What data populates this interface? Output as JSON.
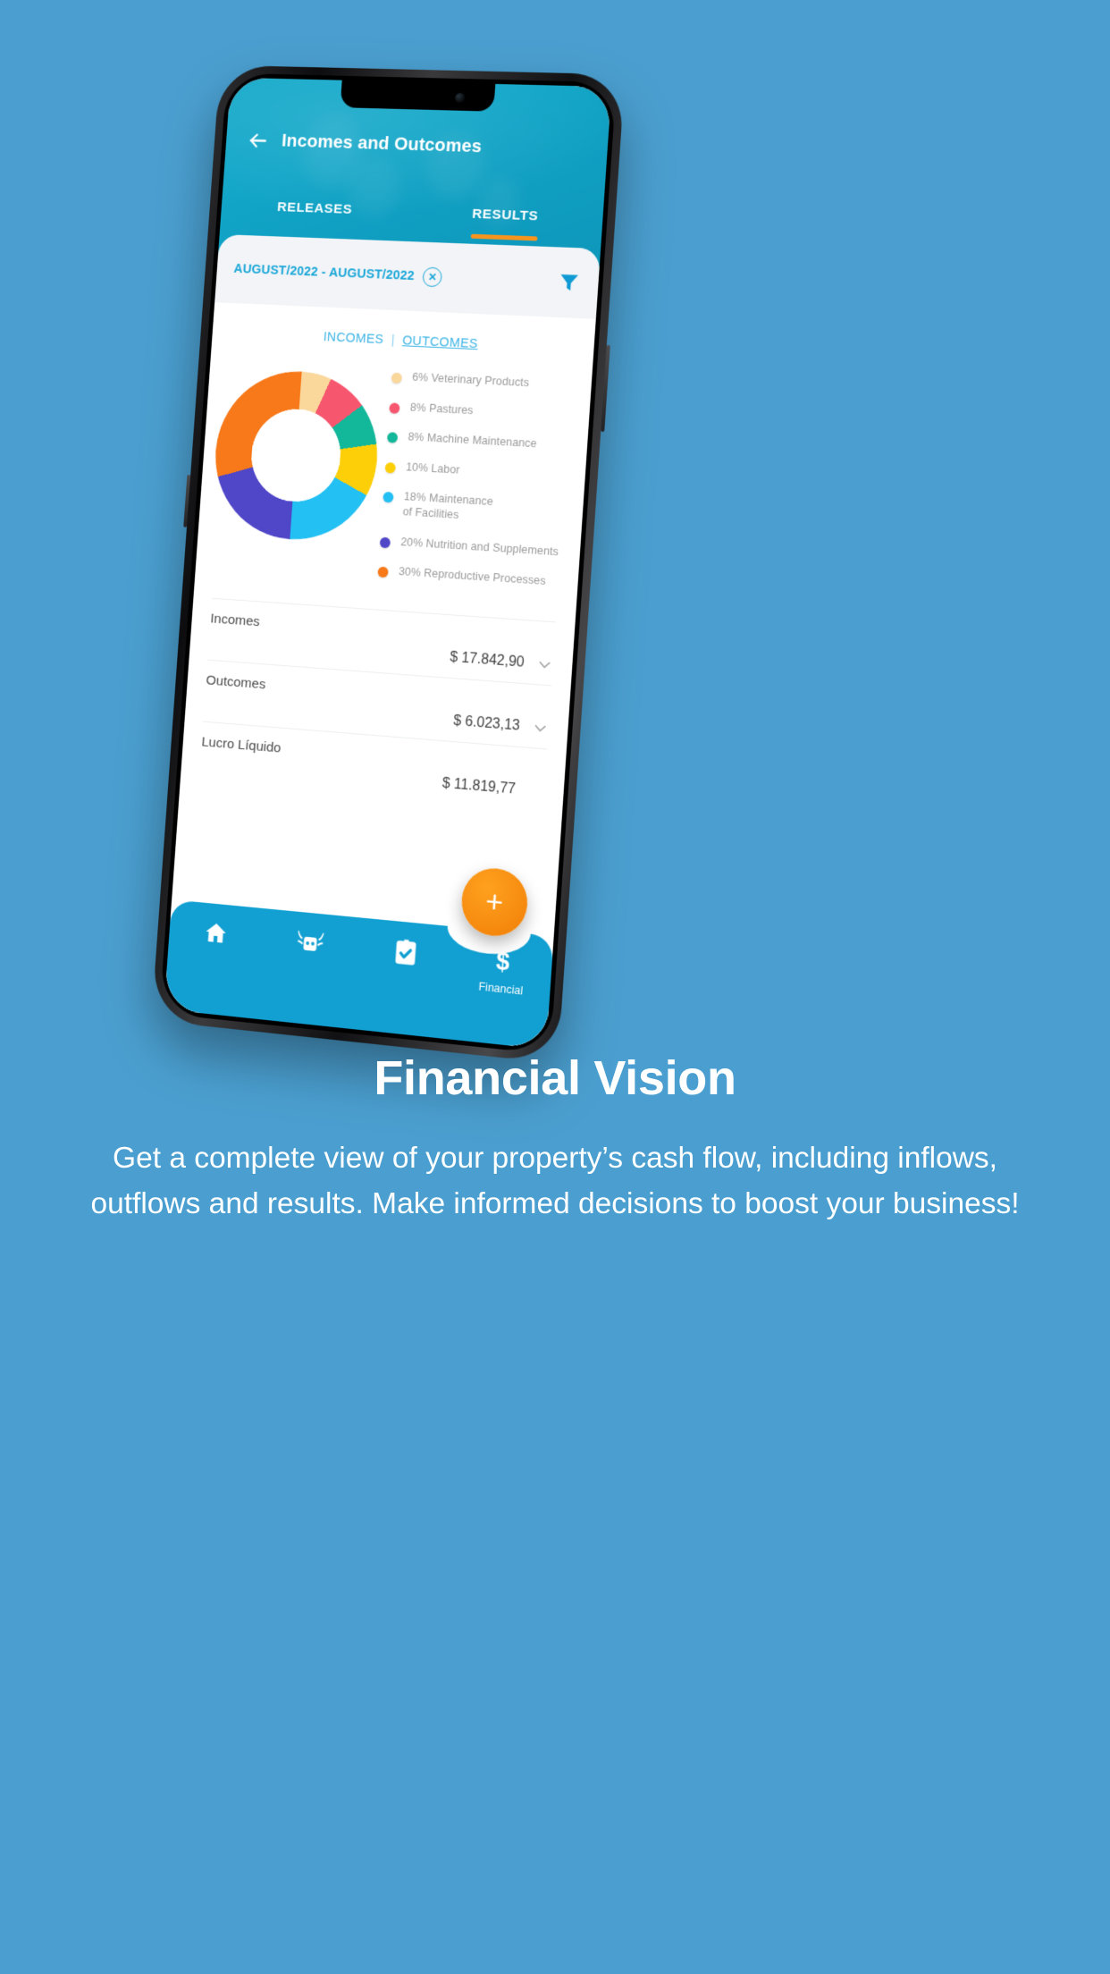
{
  "phone": {
    "app": {
      "header": {
        "back_icon": "arrow-left-icon",
        "title": "Incomes and Outcomes",
        "tabs": [
          {
            "label": "RELEASES",
            "active": false
          },
          {
            "label": "RESULTS",
            "active": true
          }
        ],
        "active_underline_color": "#f7941d",
        "background_color": "#12a6c8"
      },
      "filter_bar": {
        "date_range": "AUGUST/2022 - AUGUST/2022",
        "clear_icon": "close-circle-icon",
        "filter_icon": "funnel-filter-icon",
        "background_color": "#f2f4f7",
        "text_color": "#1aa7d8"
      },
      "view_toggle": {
        "incomes_label": "INCOMES",
        "separator": "|",
        "outcomes_label": "OUTCOMES",
        "selected": "OUTCOMES"
      },
      "summary_rows": [
        {
          "label": "Incomes",
          "value": "$ 17.842,90",
          "has_chevron": true
        },
        {
          "label": "Outcomes",
          "value": "$ 6.023,13",
          "has_chevron": true
        },
        {
          "label": "Lucro Líquido",
          "value": "$ 11.819,77",
          "has_chevron": false
        }
      ],
      "fab": {
        "icon": "plus-icon",
        "label": "+",
        "color": "#f7941d"
      },
      "bottom_nav": {
        "background_color": "#12a0d2",
        "items": [
          {
            "icon": "home-icon",
            "label": "",
            "active": false
          },
          {
            "icon": "cow-icon",
            "label": "",
            "active": false
          },
          {
            "icon": "clipboard-check-icon",
            "label": "",
            "active": false
          },
          {
            "icon": "dollar-icon",
            "label": "Financial",
            "active": true
          }
        ]
      }
    }
  },
  "chart_data": {
    "type": "pie",
    "variant": "donut",
    "title": "",
    "subtitle": "",
    "legend_position": "right",
    "categories": [
      "Veterinary Products",
      "Pastures",
      "Machine Maintenance",
      "Labor",
      "Maintenance of Facilities",
      "Nutrition and Supplements",
      "Reproductive Processes"
    ],
    "values": [
      6,
      8,
      8,
      10,
      18,
      20,
      30
    ],
    "unit": "%",
    "colors": [
      "#fad79b",
      "#f7566f",
      "#13b79a",
      "#fdcf09",
      "#22c0f3",
      "#4f46c8",
      "#f7791a"
    ],
    "legend": [
      {
        "label": "6% Veterinary Products",
        "percent": 6,
        "name": "Veterinary Products",
        "color": "#fad79b"
      },
      {
        "label": "8% Pastures",
        "percent": 8,
        "name": "Pastures",
        "color": "#f7566f"
      },
      {
        "label": "8% Machine Maintenance",
        "percent": 8,
        "name": "Machine Maintenance",
        "color": "#13b79a"
      },
      {
        "label": "10% Labor",
        "percent": 10,
        "name": "Labor",
        "color": "#fdcf09"
      },
      {
        "label": "18% Maintenance\nof Facilities",
        "percent": 18,
        "name": "Maintenance of Facilities",
        "color": "#22c0f3"
      },
      {
        "label": "20% Nutrition and Supplements",
        "percent": 20,
        "name": "Nutrition and Supplements",
        "color": "#4f46c8"
      },
      {
        "label": "30% Reproductive Processes",
        "percent": 30,
        "name": "Reproductive Processes",
        "color": "#f7791a"
      }
    ]
  },
  "marketing": {
    "title": "Financial Vision",
    "body": "Get a complete view of your property’s cash flow, including inflows, outflows and results. Make informed decisions to boost your business!"
  },
  "page": {
    "background_color": "#4a9fd0"
  }
}
